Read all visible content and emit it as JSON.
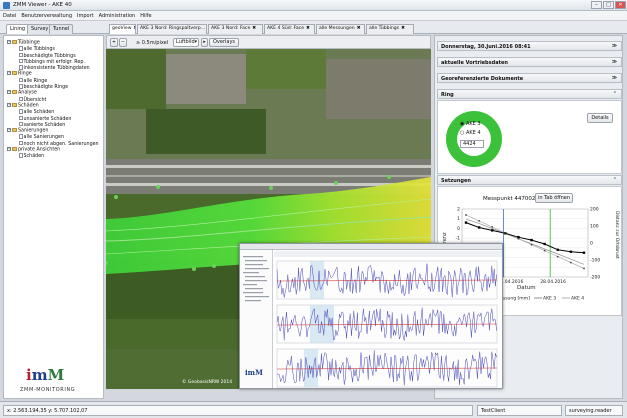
{
  "window": {
    "title": "ZMM Viewer - AKE 40",
    "min": "–",
    "max": "□",
    "close": "✕"
  },
  "menu": [
    "Datei",
    "Benutzerverwaltung",
    "Import",
    "Administration",
    "Hilfe"
  ],
  "left_tabs": [
    "Lining",
    "Survey",
    "Tunnel"
  ],
  "main_tabs": [
    "geoView",
    "AKE 3 Nord: Ringspaltverp...",
    "AKE 3 Nord: Face",
    "AKE 4 Süd: Face",
    "alle Messungen",
    "alle Tübbings"
  ],
  "tab_close": "✖",
  "tree": [
    {
      "label": "Tübbinge",
      "children": [
        "alle Tübbings",
        "beschädigte Tübbings",
        "Tübbings mit erfolgr. Rep.",
        "inkonsistente Tübbingdaten"
      ]
    },
    {
      "label": "Ringe",
      "children": [
        "alle Ringe",
        "beschädigte Ringe"
      ]
    },
    {
      "label": "Analyse",
      "children": [
        "Übersicht"
      ]
    },
    {
      "label": "Schäden",
      "children": [
        "alle Schäden",
        "unsanierte Schäden",
        "sanierte Schäden"
      ]
    },
    {
      "label": "Sanierungen",
      "children": [
        "alle Sanierungen",
        "noch nicht abgen. Sanierungen"
      ]
    },
    {
      "label": "private Ansichten",
      "children": [
        "Schäden"
      ]
    }
  ],
  "logo": {
    "mark": "imM",
    "text": "ZMM-MONITORING"
  },
  "map_toolbar": {
    "scale": "≥ 0.5m/pixel",
    "layer": "Luftbild",
    "overlays": "Overlays",
    "zoom_in": "+",
    "zoom_out": "−"
  },
  "map_copyright": "© GeobasisNRW 2014",
  "right_panel": {
    "date": "Donnerstag, 30.Juni.2016 08:41",
    "sections": [
      "aktuelle Vortriebsdaten",
      "Georeferenzierte Dokumente",
      "Ring",
      "Setzungen"
    ],
    "ring": {
      "options": [
        "AKE 3",
        "AKE 4"
      ],
      "value": "4424",
      "details": "Details"
    },
    "setzungen": {
      "title": "Messpunkt 4470021",
      "open_tab": "in Tab öffnen",
      "legend": [
        "Nullmessung [mm]",
        "AKE 3",
        "AKE 4"
      ]
    },
    "chev": "≫",
    "chev_up": "⌃"
  },
  "chart_data": {
    "type": "line",
    "title": "Messpunkt 4470021",
    "xlabel": "Datum",
    "ylabel_left": "Differenz",
    "ylabel_right": "Distanz zur Ortsbrust",
    "x_ticks": [
      "21.04.2016",
      "28.04.2016"
    ],
    "y_left_ticks": [
      2,
      1,
      0,
      -1,
      -2,
      -3,
      -4,
      -5
    ],
    "y_right_ticks": [
      200,
      100,
      0,
      -100,
      -200
    ],
    "ylim_left": [
      -5,
      2
    ],
    "ylim_right": [
      -200,
      200
    ],
    "series": [
      {
        "name": "Nullmessung [mm]",
        "values": [
          0.6,
          0.1,
          -0.2,
          -0.5,
          -0.9,
          -1.2,
          -1.6,
          -2.2,
          -2.4,
          -2.5
        ]
      },
      {
        "name": "AKE 3",
        "values": [
          140,
          115,
          85,
          55,
          25,
          -5,
          -35,
          -65,
          -95,
          -125
        ]
      },
      {
        "name": "AKE 4",
        "values": [
          165,
          130,
          95,
          60,
          25,
          -10,
          -45,
          -80,
          -115,
          -150
        ]
      }
    ]
  },
  "status": {
    "coords": "x: 2.563.194,35 y: 5.707.102,07",
    "client": "TestClient",
    "user": "surveying.reader"
  }
}
